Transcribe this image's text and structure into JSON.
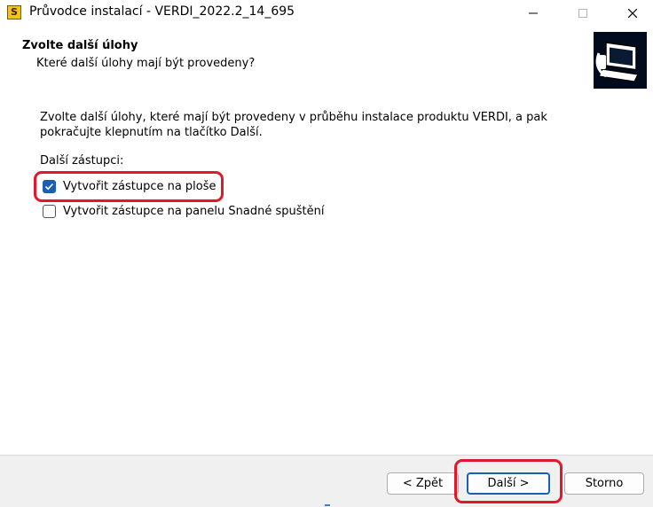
{
  "window": {
    "icon_letter": "S",
    "title": "Průvodce instalací - VERDI_2022.2_14_695",
    "controls": [
      "minimize-icon",
      "maximize-icon",
      "close-icon"
    ]
  },
  "header": {
    "heading": "Zvolte další úlohy",
    "subheading": "Které další úlohy mají být provedeny?",
    "image_icon": "computer-setup-icon"
  },
  "main": {
    "description": "Zvolte další úlohy, které mají být provedeny v průběhu instalace produktu VERDI, a pak pokračujte klepnutím na tlačítko Další.",
    "group_label": "Další zástupci:",
    "options": [
      {
        "label": "Vytvořit zástupce na ploše",
        "checked": true
      },
      {
        "label": "Vytvořit zástupce na panelu Snadné spuštění",
        "checked": false
      }
    ]
  },
  "footer": {
    "back_label": "< Zpět",
    "next_label": "Další >",
    "cancel_label": "Storno"
  },
  "colors": {
    "accent": "#1a5fb4",
    "highlight": "#e0192a",
    "footer_bg": "#f0f0f0"
  }
}
